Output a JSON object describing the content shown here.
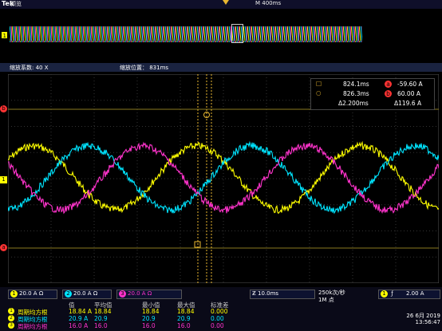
{
  "topbar": {
    "logo": "Tek",
    "mode": "预览",
    "timebase": "M 400ms"
  },
  "overview": {
    "channel_marker": "1"
  },
  "zoom": {
    "factor_label": "缩放系数: 40 X",
    "position_label": "缩放位置： 831ms"
  },
  "cursor_readout": {
    "t1": "824.1ms",
    "a_value": "-59.60 A",
    "t2": "826.3ms",
    "b_value": "60.00 A",
    "dt": "Δ2.200ms",
    "dv": "Δ119.6 A",
    "a_label": "a",
    "b_label": "b"
  },
  "markers": {
    "cursor_a": "b",
    "cursor_b": "a",
    "ch1": "1"
  },
  "bottom": {
    "ch1_scale": "20.0 A Ω",
    "ch2_scale": "20.0 A Ω",
    "ch3_scale": "20.0 A Ω",
    "timebase": "10.0ms",
    "sample": "250k次/秒",
    "points": "1M 点",
    "trig_ch": "1",
    "trig_level": "2.00 A",
    "date": "26 6月 2019",
    "time": "13:56:47",
    "headers": [
      "值",
      "平均值",
      "最小值",
      "最大值",
      "标准差"
    ],
    "rows": [
      {
        "ch": "1",
        "name": "周期均方根",
        "vals": [
          "18.84 A",
          "18.84",
          "18.84",
          "18.84",
          "0.000"
        ]
      },
      {
        "ch": "2",
        "name": "周期均方根",
        "vals": [
          "20.9 A",
          "20.9",
          "20.9",
          "20.9",
          "0.00"
        ]
      },
      {
        "ch": "3",
        "name": "周期均方根",
        "vals": [
          "16.0 A",
          "16.0",
          "16.0",
          "16.0",
          "0.00"
        ]
      }
    ]
  },
  "colors": {
    "ch1": "#ffff00",
    "ch2": "#00e5ff",
    "ch3": "#ff33cc",
    "cursor": "#e8b630",
    "bg": "#000000"
  }
}
